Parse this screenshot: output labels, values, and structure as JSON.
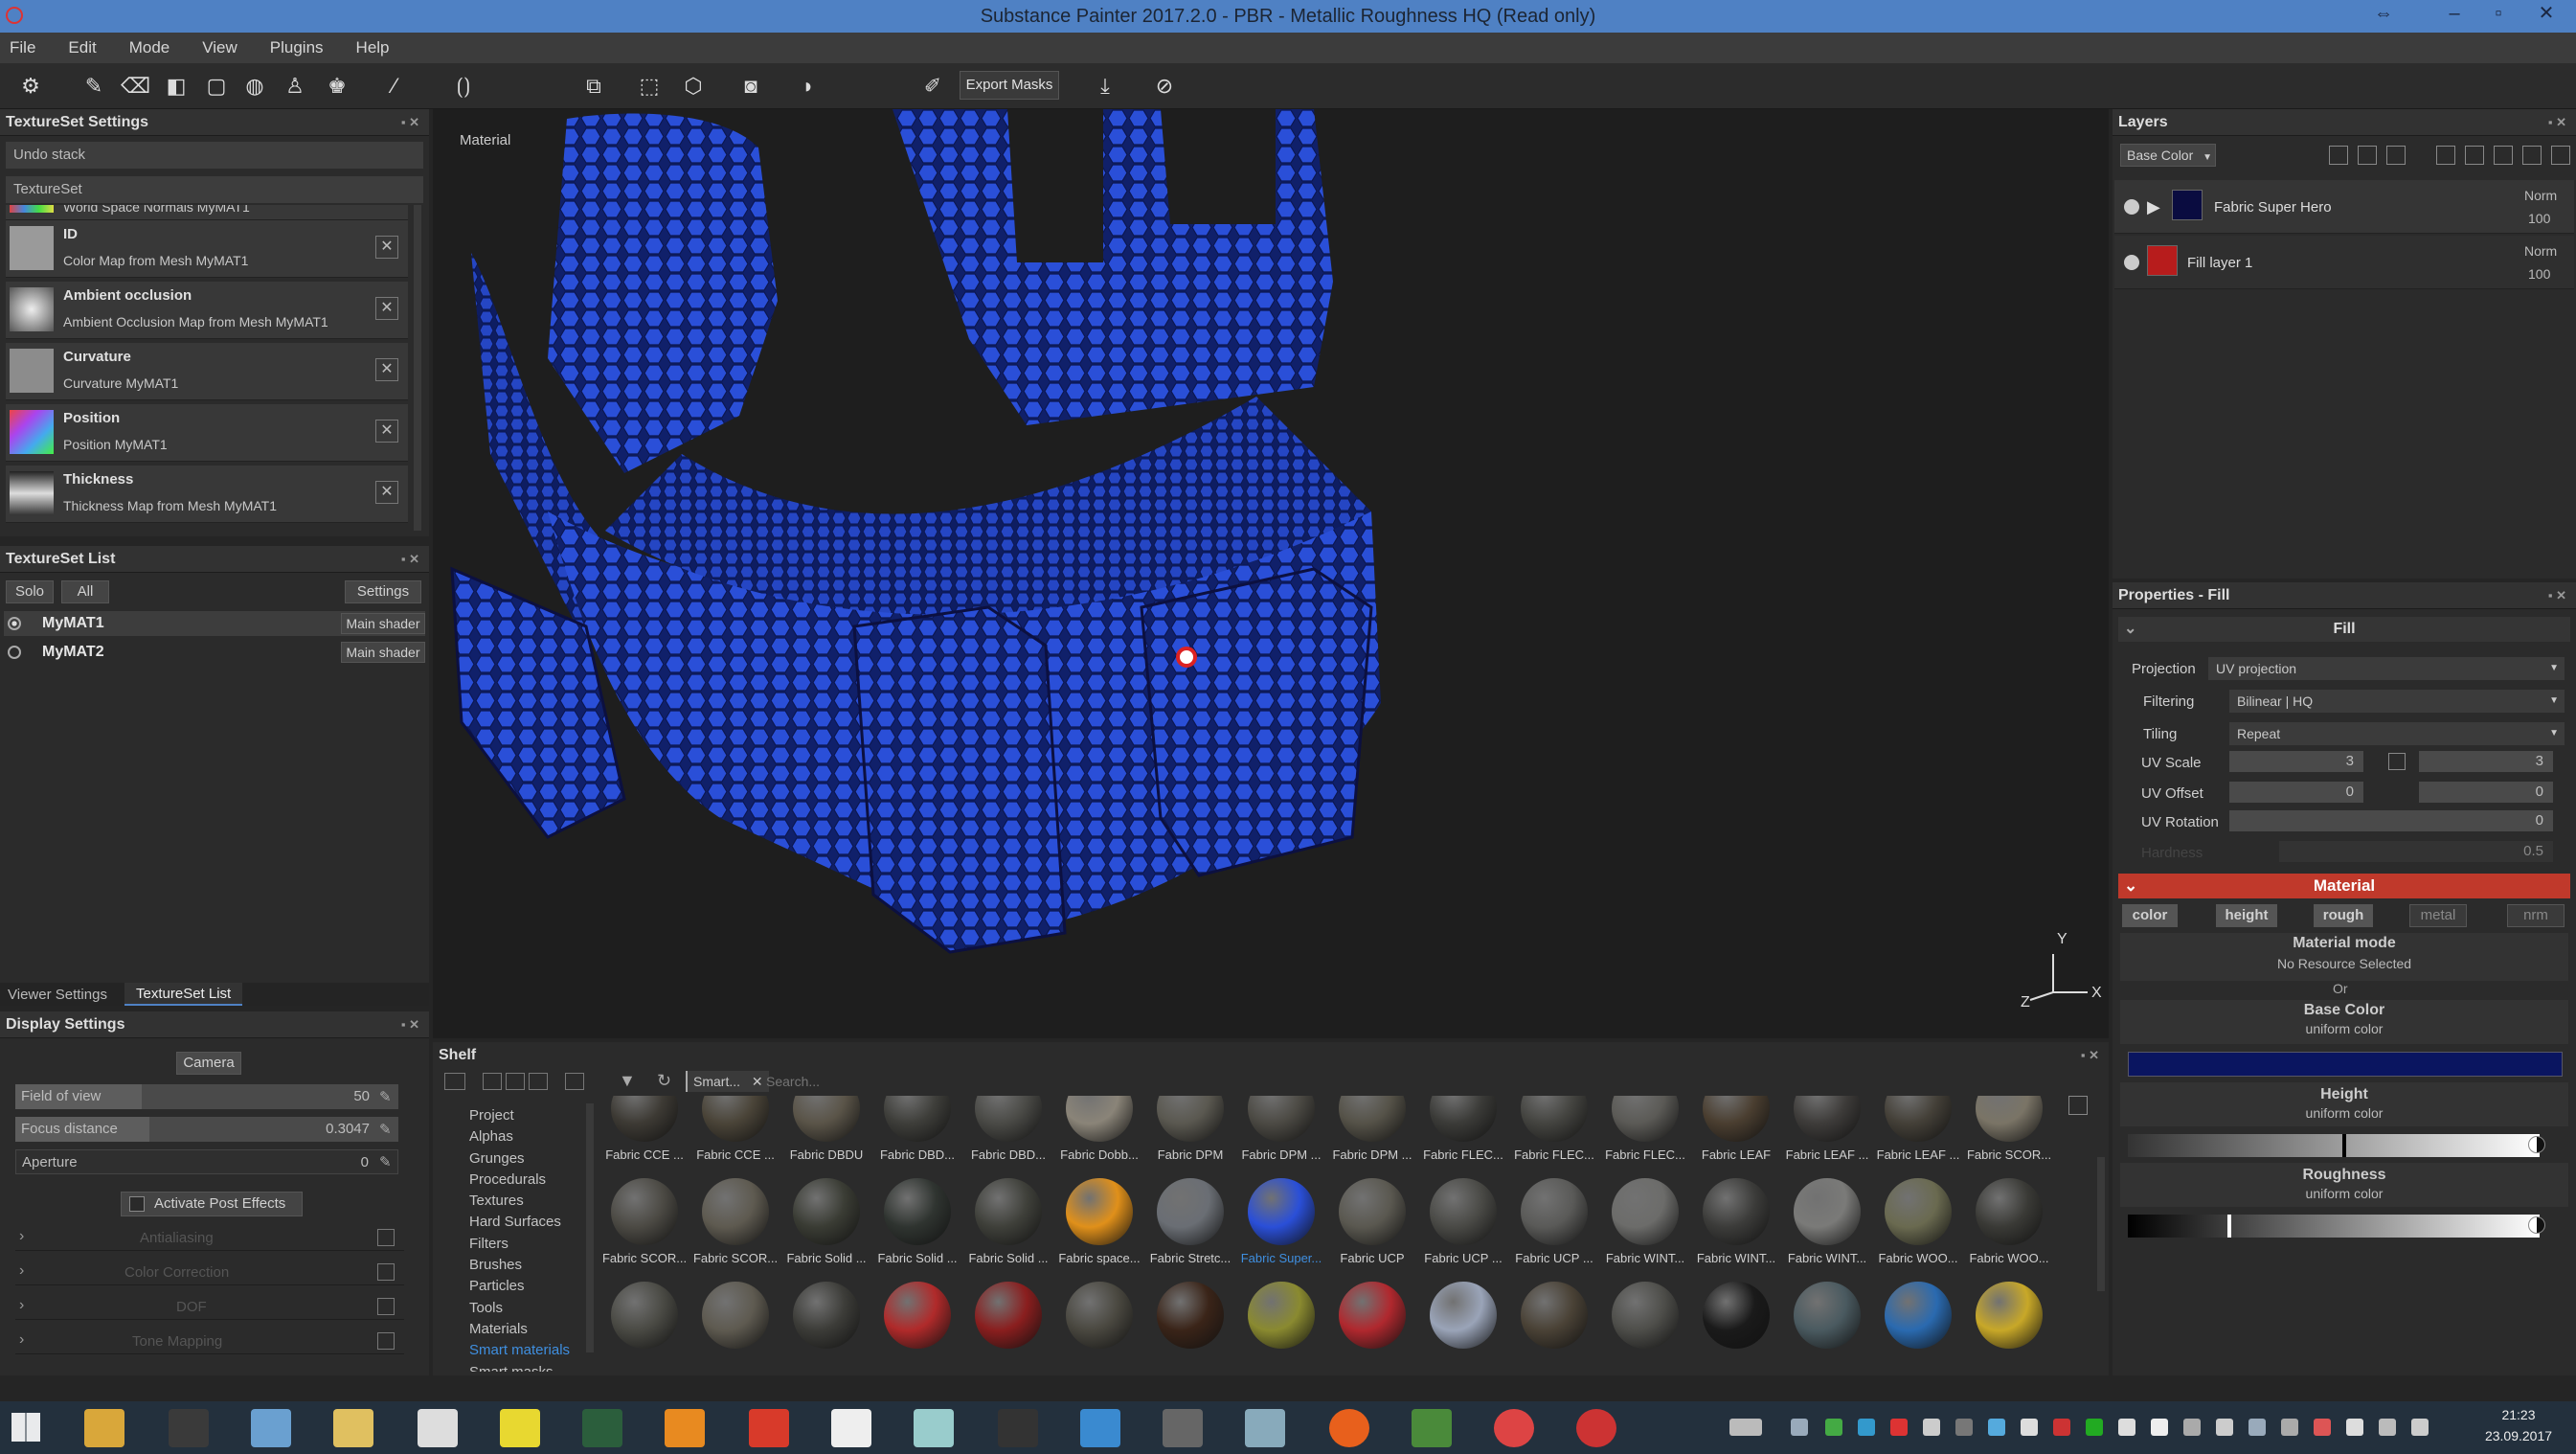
{
  "window": {
    "title": "Substance Painter 2017.2.0 - PBR - Metallic Roughness HQ (Read only)"
  },
  "menu": [
    "File",
    "Edit",
    "Mode",
    "View",
    "Plugins",
    "Help"
  ],
  "toolbar": {
    "export_masks": "Export Masks"
  },
  "textureset_settings": {
    "title": "TextureSet Settings",
    "undo_stack": "Undo stack",
    "textureset": "TextureSet",
    "rows": [
      {
        "name": "",
        "desc": "World Space Normals MyMAT1"
      },
      {
        "name": "ID",
        "desc": "Color Map from Mesh MyMAT1"
      },
      {
        "name": "Ambient occlusion",
        "desc": "Ambient Occlusion Map from Mesh MyMAT1"
      },
      {
        "name": "Curvature",
        "desc": "Curvature MyMAT1"
      },
      {
        "name": "Position",
        "desc": "Position MyMAT1"
      },
      {
        "name": "Thickness",
        "desc": "Thickness Map from Mesh MyMAT1"
      }
    ]
  },
  "textureset_list": {
    "title": "TextureSet List",
    "solo": "Solo",
    "all": "All",
    "settings": "Settings",
    "items": [
      {
        "name": "MyMAT1",
        "shader": "Main shader"
      },
      {
        "name": "MyMAT2",
        "shader": "Main shader"
      }
    ]
  },
  "tabs_left": [
    "Viewer Settings",
    "TextureSet List"
  ],
  "display_settings": {
    "title": "Display Settings",
    "camera": "Camera",
    "fov": {
      "label": "Field of view",
      "value": "50",
      "fraction": 0.33
    },
    "focus": {
      "label": "Focus distance",
      "value": "0.3047",
      "fraction": 0.35
    },
    "aperture": {
      "label": "Aperture",
      "value": "0",
      "fraction": 0.0
    },
    "post_effects": "Activate Post Effects",
    "sections": [
      "Antialiasing",
      "Color Correction",
      "DOF",
      "Tone Mapping"
    ]
  },
  "viewport": {
    "label": "Material",
    "axis_y": "Y",
    "axis_z": "Z",
    "axis_x": "X"
  },
  "shelf": {
    "title": "Shelf",
    "filter_tag": "Smart...",
    "search_placeholder": "Search...",
    "categories": [
      "Project",
      "Alphas",
      "Grunges",
      "Procedurals",
      "Textures",
      "Hard Surfaces",
      "Filters",
      "Brushes",
      "Particles",
      "Tools",
      "Materials",
      "Smart materials",
      "Smart masks"
    ],
    "active_category": "Smart materials",
    "row1": [
      "Fabric CCE ...",
      "Fabric CCE ...",
      "Fabric DBDU",
      "Fabric DBD...",
      "Fabric DBD...",
      "Fabric Dobb...",
      "Fabric DPM",
      "Fabric DPM ...",
      "Fabric DPM ...",
      "Fabric FLEC...",
      "Fabric FLEC...",
      "Fabric FLEC...",
      "Fabric LEAF",
      "Fabric LEAF ...",
      "Fabric LEAF ...",
      "Fabric SCOR..."
    ],
    "row2": [
      "Fabric SCOR...",
      "Fabric SCOR...",
      "Fabric Solid ...",
      "Fabric Solid ...",
      "Fabric Solid ...",
      "Fabric space...",
      "Fabric Stretc...",
      "Fabric Super...",
      "Fabric UCP",
      "Fabric UCP ...",
      "Fabric UCP ...",
      "Fabric WINT...",
      "Fabric WINT...",
      "Fabric WINT...",
      "Fabric WOO...",
      "Fabric WOO..."
    ],
    "highlighted": "Fabric Super..."
  },
  "layers": {
    "title": "Layers",
    "channel": "Base Color",
    "items": [
      {
        "name": "Fabric Super Hero",
        "blend": "Norm",
        "opacity": "100"
      },
      {
        "name": "Fill layer 1",
        "blend": "Norm",
        "opacity": "100"
      }
    ]
  },
  "properties": {
    "title": "Properties - Fill",
    "fill": "Fill",
    "projection": {
      "label": "Projection",
      "value": "UV projection"
    },
    "filtering": {
      "label": "Filtering",
      "value": "Bilinear | HQ"
    },
    "tiling": {
      "label": "Tiling",
      "value": "Repeat"
    },
    "uv_scale": {
      "label": "UV Scale",
      "value": "3",
      "value2": "3"
    },
    "uv_offset": {
      "label": "UV Offset",
      "value": "0",
      "value2": "0"
    },
    "uv_rotation": {
      "label": "UV Rotation",
      "value": "0"
    },
    "hardness": {
      "label": "Hardness",
      "value": "0.5"
    },
    "material": "Material",
    "channels": [
      "color",
      "height",
      "rough",
      "metal",
      "nrm"
    ],
    "material_mode": "Material mode",
    "no_resource": "No Resource Selected",
    "or": "Or",
    "base_color": "Base Color",
    "uniform_color": "uniform color",
    "height": "Height",
    "roughness": "Roughness",
    "base_color_hex": "#0a1560"
  },
  "clock": {
    "time": "21:23",
    "date": "23.09.2017"
  },
  "colors": {
    "accent": "#c0392b",
    "title_bar": "#4f81c4",
    "fabric_blue": "#2a4fd8"
  }
}
